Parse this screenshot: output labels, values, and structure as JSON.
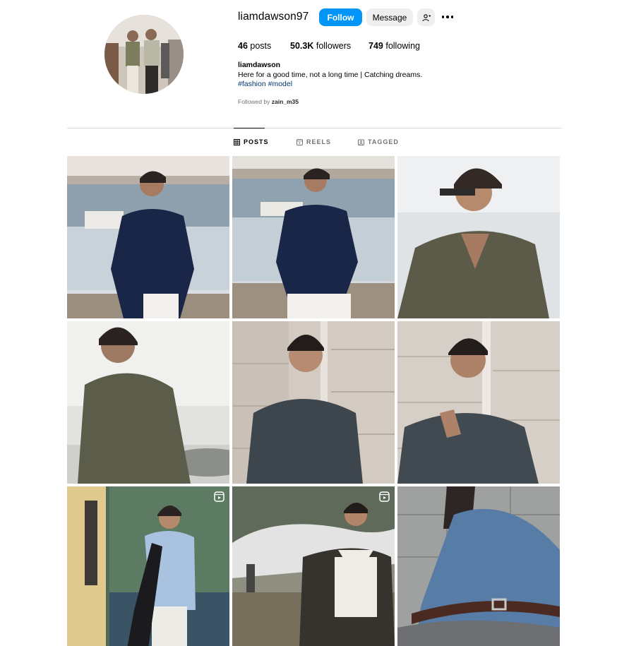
{
  "profile": {
    "username": "liamdawson97",
    "full_name": "liamdawson",
    "bio": "Here for a good time, not a long time | Catching dreams.",
    "hashtags": "#fashion #model",
    "followed_by_prefix": "Followed by",
    "followed_by_user": "zain_m35"
  },
  "actions": {
    "follow_label": "Follow",
    "message_label": "Message",
    "suggest_icon": "add-person-icon",
    "more_icon": "more-options-icon"
  },
  "stats": {
    "posts_count": "46",
    "posts_label": "posts",
    "followers_count": "50.3K",
    "followers_label": "followers",
    "following_count": "749",
    "following_label": "following"
  },
  "tabs": [
    {
      "label": "POSTS",
      "icon": "grid-icon",
      "active": true
    },
    {
      "label": "REELS",
      "icon": "reels-icon",
      "active": false
    },
    {
      "label": "TAGGED",
      "icon": "tagged-icon",
      "active": false
    }
  ],
  "posts": [
    {
      "type": "photo",
      "reel": false
    },
    {
      "type": "photo",
      "reel": false
    },
    {
      "type": "photo",
      "reel": false
    },
    {
      "type": "photo",
      "reel": false
    },
    {
      "type": "photo",
      "reel": false
    },
    {
      "type": "photo",
      "reel": false
    },
    {
      "type": "reel",
      "reel": true
    },
    {
      "type": "reel",
      "reel": true
    },
    {
      "type": "photo",
      "reel": false
    }
  ],
  "colors": {
    "accent": "#0095f6",
    "secondary_button": "#efefef",
    "hashtag": "#00376b",
    "muted": "#737373",
    "divider": "#dbdbdb"
  }
}
